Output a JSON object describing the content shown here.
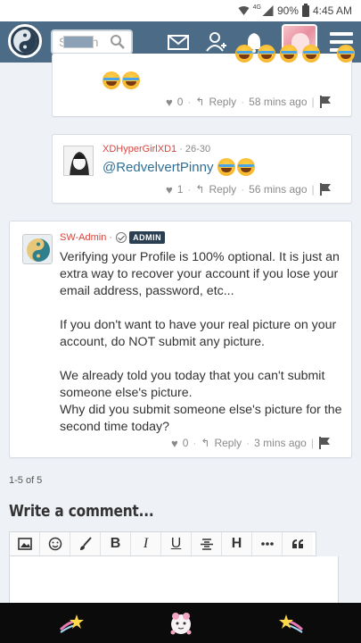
{
  "status_bar": {
    "network": "4G",
    "battery": "90%",
    "time": "4:45 AM"
  },
  "navbar": {
    "search_placeholder": "Search"
  },
  "comments": [
    {
      "likes": "0",
      "reply_label": "Reply",
      "time": "58 mins ago"
    },
    {
      "author": "XDHyperGirlXD1",
      "age": "26-30",
      "mention": "@RedvelvertPinny",
      "likes": "1",
      "reply_label": "Reply",
      "time": "56 mins ago"
    },
    {
      "author": "SW-Admin",
      "badge": "ADMIN",
      "paragraphs": [
        "Verifying your Profile is 100% optional. It is just an extra way to recover your account if you lose your email address, password, etc...",
        "If you don't want to have your real picture on your account, do NOT submit any picture.",
        "We already told you today that you can't submit someone else's picture.\nWhy did you submit someone else's picture for the second time today?"
      ],
      "likes": "0",
      "reply_label": "Reply",
      "time": "3 mins ago"
    }
  ],
  "pager": "1-5 of 5",
  "write_comment": {
    "title": "Write a comment...",
    "toolbar": [
      "image-icon",
      "emoji-icon",
      "brush-icon",
      "B",
      "I",
      "U",
      "strikethrough-icon",
      "H",
      "more-icon",
      "quote-icon"
    ]
  },
  "colors": {
    "nav": "#4c6b86",
    "author": "#d6453c",
    "mention": "#2f6f95",
    "admin_badge": "#2b3f52"
  }
}
